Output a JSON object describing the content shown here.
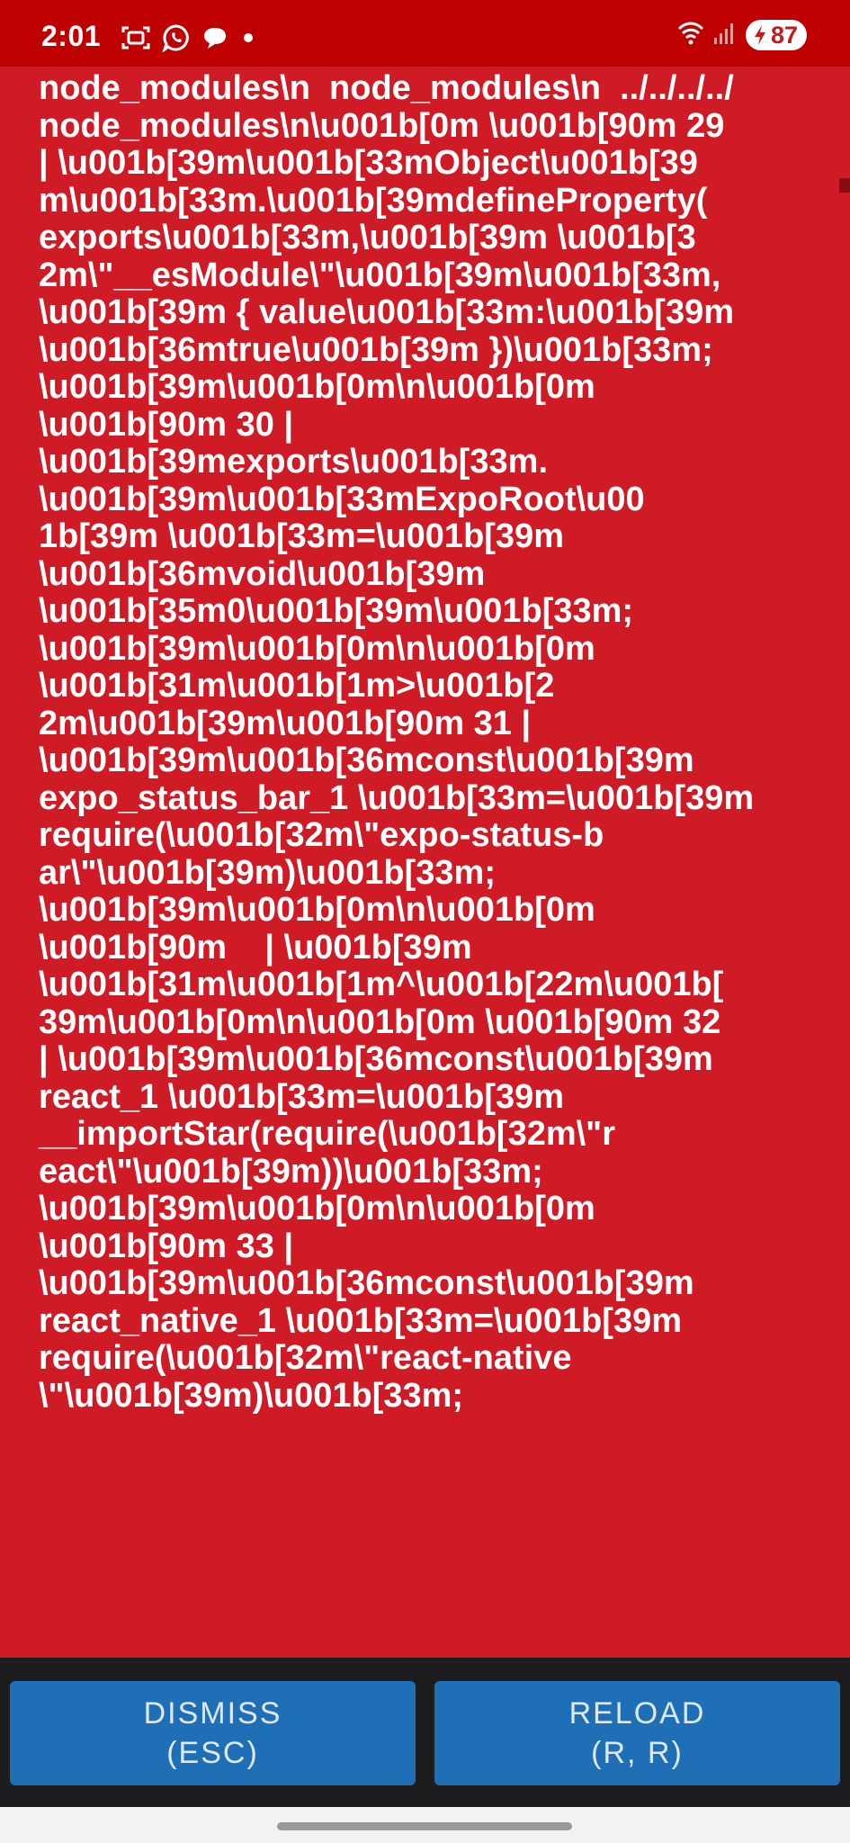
{
  "status_bar": {
    "time": "2:01",
    "battery": "87",
    "notification_icons": [
      "screenshot-icon",
      "whatsapp-icon",
      "chat-bubble-icon",
      "dot-icon"
    ],
    "system_icons": [
      "wifi-icon",
      "signal-icon",
      "battery-charging-icon"
    ]
  },
  "error": {
    "log_lines": [
      "node_modules\\n  node_modules\\n  ../../../../",
      "node_modules\\n\\u001b[0m \\u001b[90m 29",
      "| \\u001b[39m\\u001b[33mObject\\u001b[39",
      "m\\u001b[33m.\\u001b[39mdefineProperty(",
      "exports\\u001b[33m,\\u001b[39m \\u001b[3",
      "2m\\\"__esModule\\\"\\u001b[39m\\u001b[33m,",
      "\\u001b[39m { value\\u001b[33m:\\u001b[39m",
      "\\u001b[36mtrue\\u001b[39m })\\u001b[33m;",
      "\\u001b[39m\\u001b[0m\\n\\u001b[0m",
      "\\u001b[90m 30 |",
      "\\u001b[39mexports\\u001b[33m.",
      "\\u001b[39m\\u001b[33mExpoRoot\\u00",
      "1b[39m \\u001b[33m=\\u001b[39m",
      "\\u001b[36mvoid\\u001b[39m",
      "\\u001b[35m0\\u001b[39m\\u001b[33m;",
      "\\u001b[39m\\u001b[0m\\n\\u001b[0m",
      "\\u001b[31m\\u001b[1m>\\u001b[2",
      "2m\\u001b[39m\\u001b[90m 31 |",
      "\\u001b[39m\\u001b[36mconst\\u001b[39m",
      "expo_status_bar_1 \\u001b[33m=\\u001b[39m",
      "require(\\u001b[32m\\\"expo-status-b",
      "ar\\\"\\u001b[39m)\\u001b[33m;",
      "\\u001b[39m\\u001b[0m\\n\\u001b[0m",
      "\\u001b[90m    | \\u001b[39m",
      "\\u001b[31m\\u001b[1m^\\u001b[22m\\u001b[",
      "39m\\u001b[0m\\n\\u001b[0m \\u001b[90m 32",
      "| \\u001b[39m\\u001b[36mconst\\u001b[39m",
      "react_1 \\u001b[33m=\\u001b[39m",
      "__importStar(require(\\u001b[32m\\\"r",
      "eact\\\"\\u001b[39m))\\u001b[33m;",
      "\\u001b[39m\\u001b[0m\\n\\u001b[0m",
      "\\u001b[90m 33 |",
      "\\u001b[39m\\u001b[36mconst\\u001b[39m",
      "react_native_1 \\u001b[33m=\\u001b[39m",
      "require(\\u001b[32m\\\"react-native",
      "\\\"\\u001b[39m)\\u001b[33m;"
    ]
  },
  "buttons": {
    "dismiss_label": "DISMISS",
    "dismiss_hint": "(ESC)",
    "reload_label": "RELOAD",
    "reload_hint": "(R, R)"
  },
  "colors": {
    "error_background": "#cf1b25",
    "status_bar_background": "#bf0000",
    "button_background": "#1f6fb6",
    "bottom_bar_background": "#1d1d1f"
  }
}
